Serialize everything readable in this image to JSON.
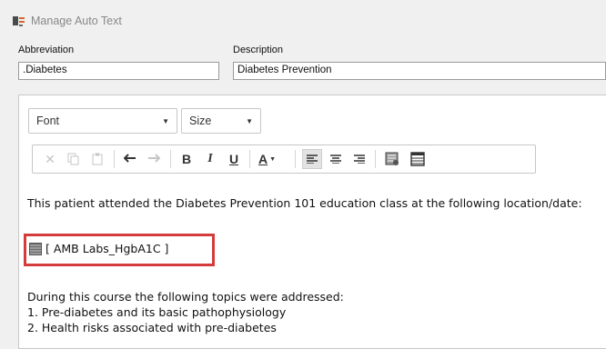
{
  "window": {
    "title": "Manage Auto Text",
    "icon": "auto-text-icon"
  },
  "fields": {
    "abbreviation_label": "Abbreviation",
    "abbreviation_value": ".Diabetes",
    "description_label": "Description",
    "description_value": "Diabetes Prevention"
  },
  "toolbar": {
    "font_label": "Font",
    "size_label": "Size",
    "buttons": [
      "cut-icon",
      "copy-icon",
      "paste-icon",
      "undo-icon",
      "redo-icon",
      "bold",
      "italic",
      "underline",
      "font-color",
      "align-left",
      "align-center",
      "align-right",
      "insert-token-icon",
      "table-icon"
    ],
    "bold": "B",
    "italic": "I",
    "underline": "U",
    "font_color": "A"
  },
  "editor": {
    "intro": "This patient attended the Diabetes Prevention 101 education class at the following location/date:",
    "token": "[ AMB Labs_HgbA1C ]",
    "line_topics": "During this course the following topics were addressed:",
    "item1": "1. Pre-diabetes and its basic pathophysiology",
    "item2": "2. Health risks associated with pre-diabetes"
  },
  "colors": {
    "highlight_border": "#d43c3c"
  }
}
